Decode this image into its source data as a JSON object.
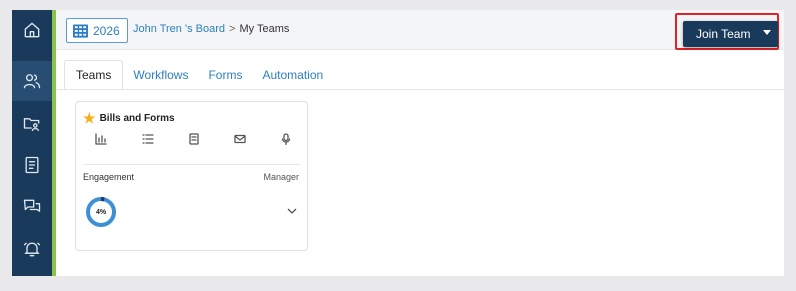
{
  "sidebar": {
    "items": [
      {
        "icon": "home-icon",
        "active": false
      },
      {
        "icon": "users-icon",
        "active": true
      },
      {
        "icon": "folder-person-icon",
        "active": false
      },
      {
        "icon": "document-icon",
        "active": false
      },
      {
        "icon": "chat-icon",
        "active": false
      },
      {
        "icon": "bell-icon",
        "active": false
      }
    ],
    "accent_color": "#8bc34a",
    "bg_color": "#1a3a5c"
  },
  "header": {
    "year": "2026",
    "breadcrumb": {
      "board": "John Tren 's Board",
      "separator": ">",
      "current": "My Teams"
    },
    "join_button": "Join Team"
  },
  "tabs": [
    {
      "label": "Teams",
      "active": true
    },
    {
      "label": "Workflows",
      "active": false
    },
    {
      "label": "Forms",
      "active": false
    },
    {
      "label": "Automation",
      "active": false
    }
  ],
  "team_card": {
    "title": "Bills and Forms",
    "icons": [
      "chart-icon",
      "list-icon",
      "book-icon",
      "mail-icon",
      "mic-icon"
    ],
    "engagement_label": "Engagement",
    "role": "Manager",
    "engagement_value": "4%",
    "engagement_fraction": 0.04
  },
  "colors": {
    "primary": "#1a3a5c",
    "link": "#2d7fc1",
    "highlight": "#e0232a",
    "star": "#f5b01b"
  }
}
